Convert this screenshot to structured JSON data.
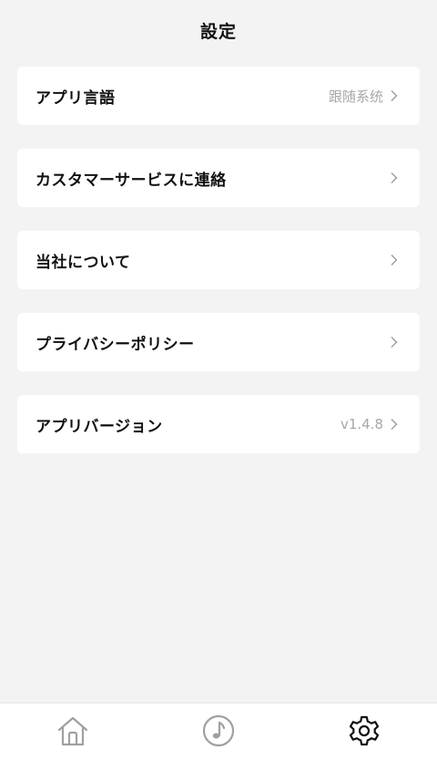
{
  "header": {
    "title": "設定"
  },
  "settings": {
    "items": [
      {
        "label": "アプリ言語",
        "value": "跟随系统"
      },
      {
        "label": "カスタマーサービスに連絡",
        "value": ""
      },
      {
        "label": "当社について",
        "value": ""
      },
      {
        "label": "プライバシーポリシー",
        "value": ""
      },
      {
        "label": "アプリバージョン",
        "value": "v1.4.8"
      }
    ]
  },
  "tabbar": {
    "tabs": [
      {
        "icon": "home-icon"
      },
      {
        "icon": "music-note-icon"
      },
      {
        "icon": "gear-icon",
        "active": true
      }
    ]
  },
  "colors": {
    "background": "#f3f3f3",
    "card": "#ffffff",
    "muted_text": "#a8a8a8"
  }
}
